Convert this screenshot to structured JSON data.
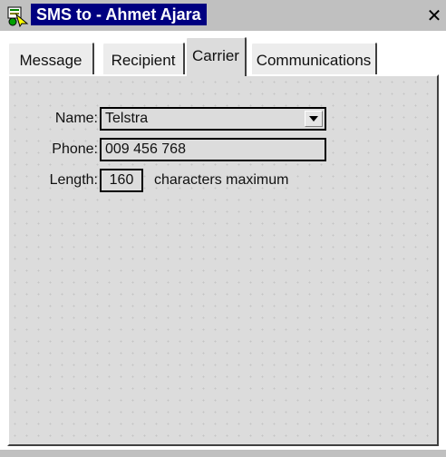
{
  "window": {
    "title": "SMS to - Ahmet Ajara",
    "close_glyph": "✕",
    "title_icon": "app-icon"
  },
  "tabs": [
    {
      "label": "Message",
      "active": false
    },
    {
      "label": "Recipient",
      "active": false
    },
    {
      "label": "Carrier",
      "active": true
    },
    {
      "label": "Communications",
      "active": false
    }
  ],
  "carrier": {
    "name_label": "Name:",
    "name_value": "Telstra",
    "phone_label": "Phone:",
    "phone_value": "009 456 768",
    "length_label": "Length:",
    "length_value": "160",
    "length_suffix": "characters maximum"
  },
  "colors": {
    "title_active": "#000080",
    "panel_bg": "#dcdcdc",
    "titlebar_bg": "#c0c0c0"
  }
}
